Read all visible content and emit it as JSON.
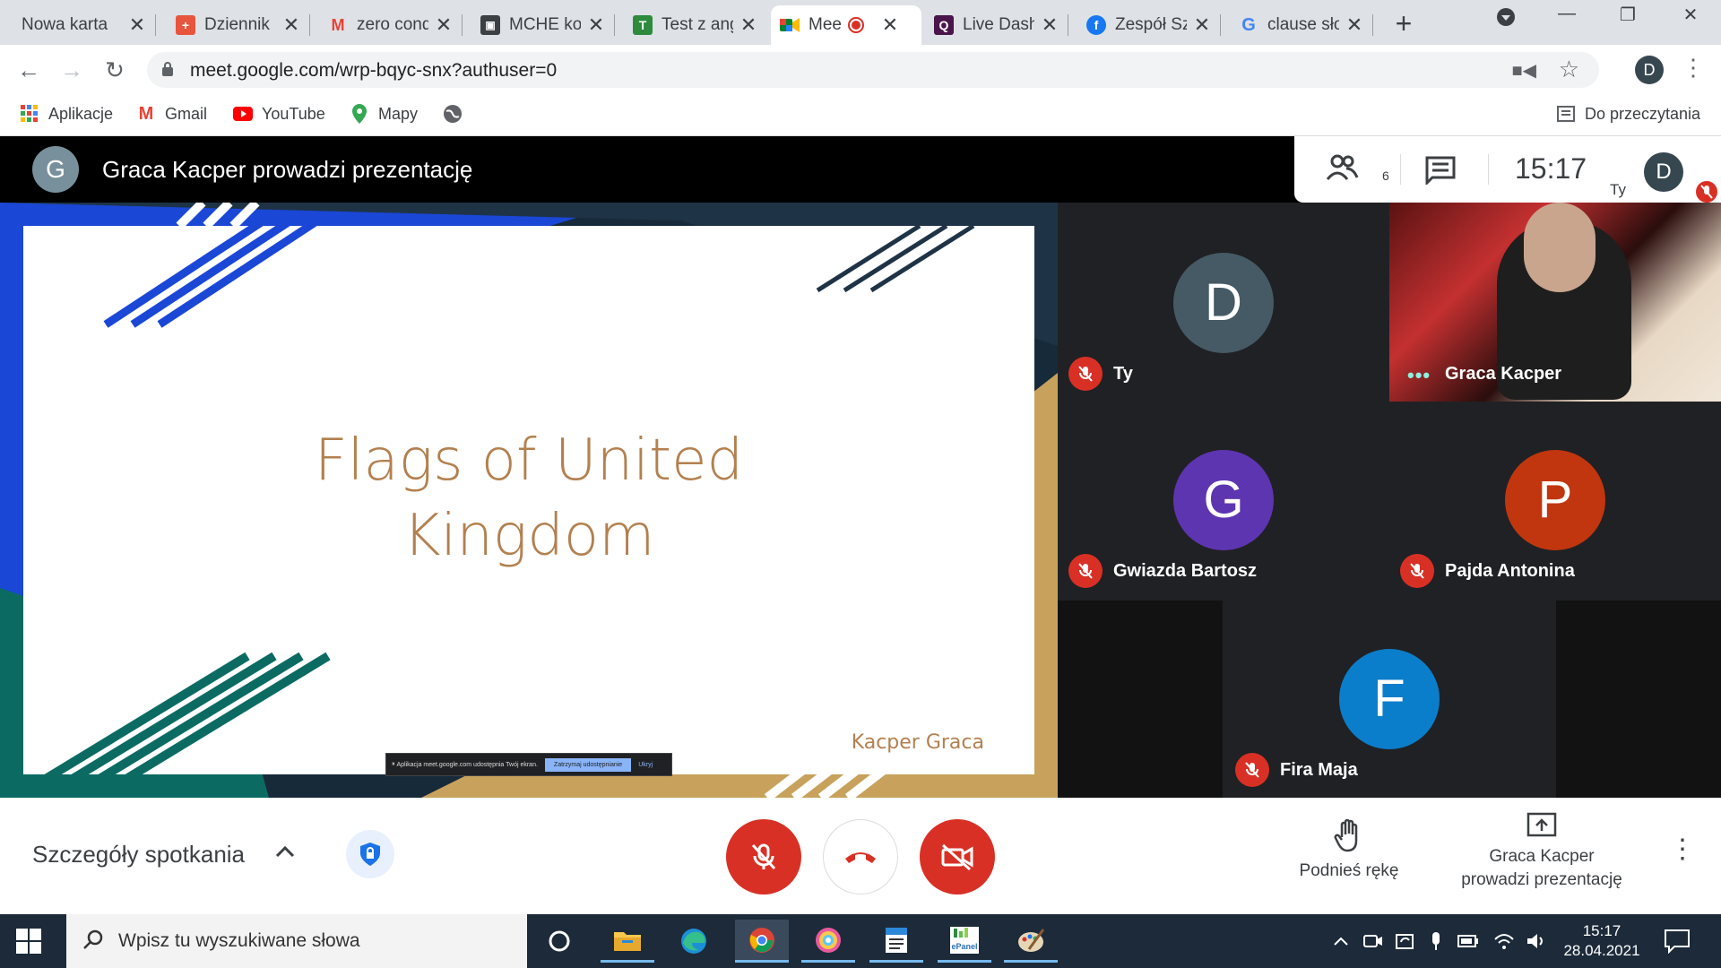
{
  "browser": {
    "tabs": [
      {
        "title": "Nowa karta",
        "icon": "blank-icon",
        "color": "#dee1e6"
      },
      {
        "title": "Dziennik",
        "icon": "librus-icon",
        "color": "#e8553d"
      },
      {
        "title": "zero cond",
        "icon": "gmail-icon",
        "color": "#ea4335"
      },
      {
        "title": "MCHE ko",
        "icon": "classroom-icon",
        "color": "#3c4043"
      },
      {
        "title": "Test z ang",
        "icon": "testportal-icon",
        "color": "#34a853"
      },
      {
        "title": "Meet",
        "icon": "meet-icon",
        "color": "#00897b"
      },
      {
        "title": "Live Dash",
        "icon": "quizizz-icon",
        "color": "#4a154b"
      },
      {
        "title": "Zespół Sz",
        "icon": "facebook-icon",
        "color": "#1877f2"
      },
      {
        "title": "clause sło",
        "icon": "google-icon",
        "color": "#4285f4"
      }
    ],
    "url": "meet.google.com/wrp-bqyc-snx?authuser=0",
    "profile_initial": "D",
    "bookmarks": [
      {
        "label": "Aplikacje",
        "icon": "apps-grid-icon"
      },
      {
        "label": "Gmail",
        "icon": "gmail-icon"
      },
      {
        "label": "YouTube",
        "icon": "youtube-icon"
      },
      {
        "label": "Mapy",
        "icon": "maps-pin-icon"
      },
      {
        "label": "",
        "icon": "globe-icon"
      }
    ],
    "reading_list": "Do przeczytania"
  },
  "meet": {
    "presenter_initial": "G",
    "presenting_title": "Graca Kacper prowadzi prezentację",
    "people_count": "6",
    "clock": "15:17",
    "self_label": "Ty",
    "self_initial": "D",
    "slide": {
      "title_line1": "Flags of United",
      "title_line2": "Kingdom",
      "author": "Kacper Graca"
    },
    "share_bar": {
      "text": "Aplikacja meet.google.com udostępnia Twój ekran.",
      "stop": "Zatrzymaj udostępnianie",
      "hide": "Ukryj"
    },
    "participants": [
      {
        "name": "Ty",
        "initial": "D",
        "color": "#455a64",
        "muted": true
      },
      {
        "name": "Graca Kacper",
        "initial": "",
        "color": "",
        "muted": false,
        "video": true
      },
      {
        "name": "Gwiazda Bartosz",
        "initial": "G",
        "color": "#5e35b1",
        "muted": true
      },
      {
        "name": "Pajda Antonina",
        "initial": "P",
        "color": "#c1360e",
        "muted": true
      },
      {
        "name": "Fira Maja",
        "initial": "F",
        "color": "#0b7ecb",
        "muted": true
      }
    ],
    "bottom": {
      "details_label": "Szczegóły spotkania",
      "raise_hand": "Podnieś rękę",
      "presenting_line1": "Graca Kacper",
      "presenting_line2": "prowadzi prezentację"
    },
    "colors": {
      "accent_red": "#d93025",
      "slide_text": "#b3804f",
      "slide_blue": "#1a47d6",
      "slide_teal": "#0b6b63",
      "slide_gold": "#c8a25c"
    }
  },
  "taskbar": {
    "search_placeholder": "Wpisz tu wyszukiwane słowa",
    "time": "15:17",
    "date": "28.04.2021",
    "apps": [
      "cortana-icon",
      "file-explorer-icon",
      "edge-icon",
      "chrome-icon",
      "photos-icon",
      "wordpad-icon",
      "epanel-icon",
      "paint-icon"
    ],
    "epanel_label": "ePanel"
  }
}
